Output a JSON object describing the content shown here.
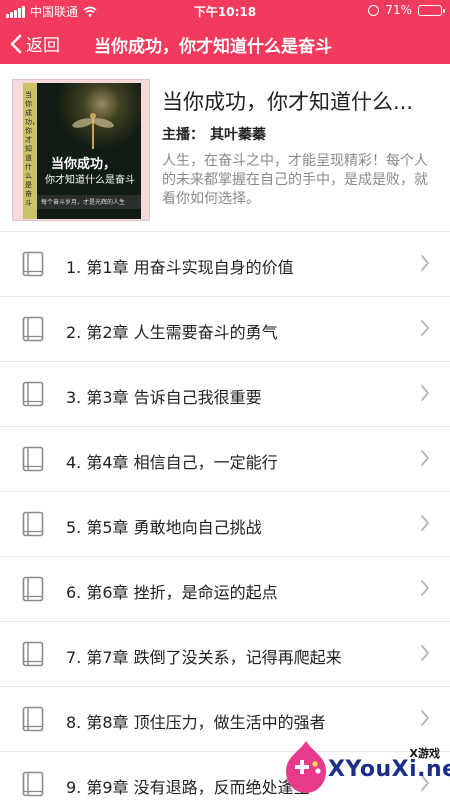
{
  "status": {
    "carrier": "中国联通",
    "time": "下午10:18",
    "battery": "71%",
    "battery_level": 0.71
  },
  "nav": {
    "back_label": "返回",
    "title": "当你成功，你才知道什么是奋斗"
  },
  "book": {
    "title": "当你成功，你才知道什么...",
    "host_label": "主播：",
    "host_name": "其叶蓁蓁",
    "description": "人生，在奋斗之中，才能呈现精彩！每个人的未来都掌握在自己的手中，是成是败，就看你如何选择。",
    "cover": {
      "spine_text": "当你成功，你才知道什么是奋斗",
      "line1": "当你成功，",
      "line2": "你才知道什么是奋斗",
      "line3": "每个奋斗岁月，才是光辉的人生"
    }
  },
  "chapters": [
    {
      "label": "1. 第1章 用奋斗实现自身的价值"
    },
    {
      "label": "2. 第2章 人生需要奋斗的勇气"
    },
    {
      "label": "3. 第3章 告诉自己我很重要"
    },
    {
      "label": "4. 第4章 相信自己，一定能行"
    },
    {
      "label": "5. 第5章 勇敢地向自己挑战"
    },
    {
      "label": "6. 第6章 挫折，是命运的起点"
    },
    {
      "label": "7. 第7章 跌倒了没关系，记得再爬起来"
    },
    {
      "label": "8. 第8章 顶住压力，做生活中的强者"
    },
    {
      "label": "9. 第9章 没有退路，反而绝处逢生"
    }
  ],
  "watermark": {
    "tag": "X游戏",
    "site": "XYouXi.net"
  },
  "colors": {
    "accent": "#f13a5c"
  },
  "icons": {
    "back": "chevron-left-icon",
    "chapter": "book-icon",
    "row_arrow": "chevron-right-icon"
  }
}
